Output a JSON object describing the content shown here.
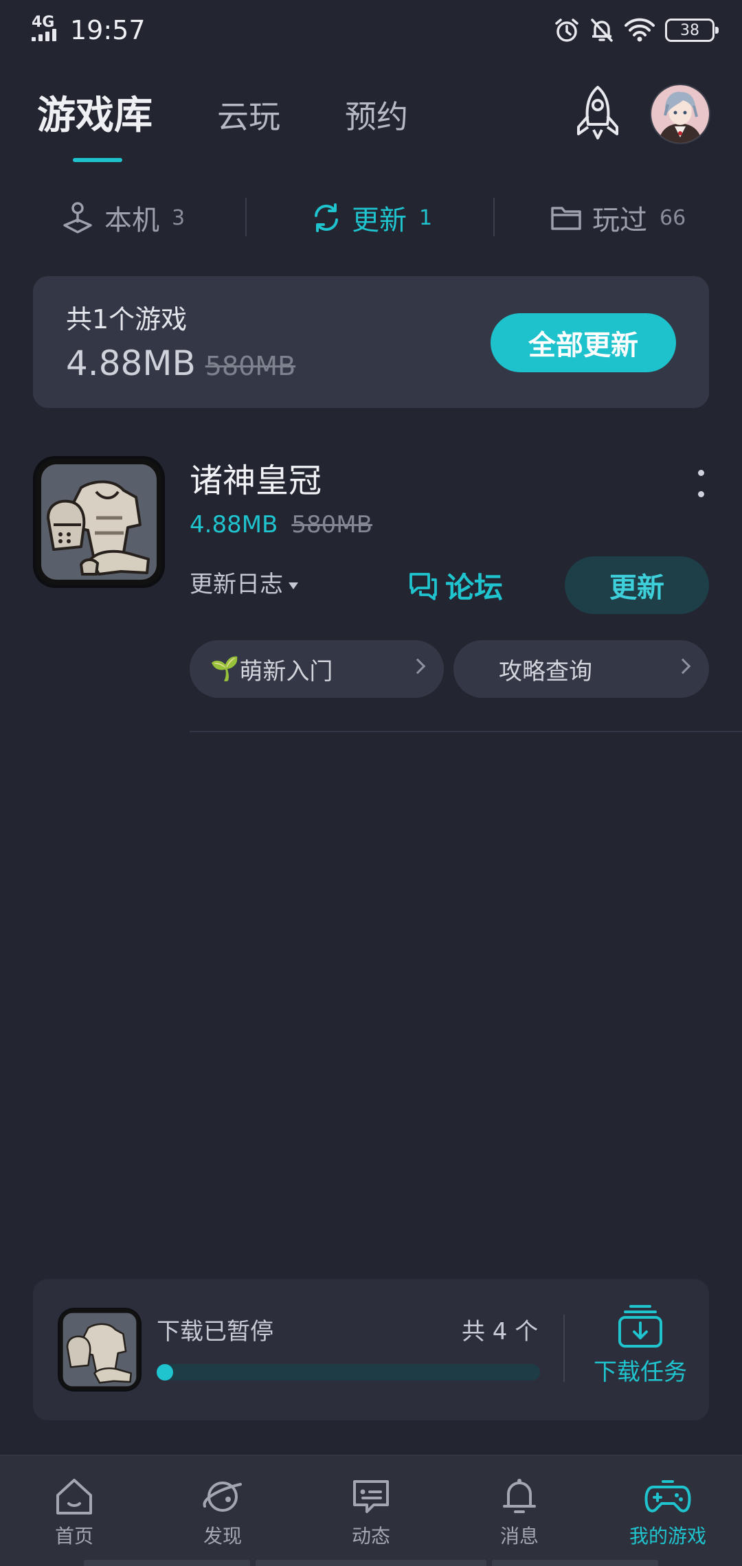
{
  "status_bar": {
    "network": "4G",
    "time": "19:57",
    "battery": "38",
    "icons": [
      "alarm-icon",
      "mute-bell-icon",
      "wifi-icon",
      "battery-icon"
    ]
  },
  "header": {
    "tabs": [
      {
        "label": "游戏库",
        "active": true
      },
      {
        "label": "云玩",
        "active": false
      },
      {
        "label": "预约",
        "active": false
      }
    ]
  },
  "subtabs": [
    {
      "label": "本机",
      "count": "3",
      "icon": "joystick-icon",
      "active": false
    },
    {
      "label": "更新",
      "count": "1",
      "icon": "refresh-icon",
      "active": true
    },
    {
      "label": "玩过",
      "count": "66",
      "icon": "folder-icon",
      "active": false
    }
  ],
  "summary": {
    "title": "共1个游戏",
    "size": "4.88MB",
    "original_size": "580MB",
    "update_all_label": "全部更新"
  },
  "game": {
    "name": "诸神皇冠",
    "size": "4.88MB",
    "original_size": "580MB",
    "changelog_label": "更新日志",
    "forum_label": "论坛",
    "update_label": "更新",
    "quick_links": [
      {
        "label": "萌新入门",
        "prefix": "🌱"
      },
      {
        "label": "攻略查询",
        "prefix": ""
      }
    ]
  },
  "download": {
    "status": "下载已暂停",
    "count": "共 4 个",
    "progress": 0.02,
    "tasks_label": "下载任务"
  },
  "bottom_nav": [
    {
      "label": "首页",
      "icon": "home-icon",
      "active": false
    },
    {
      "label": "发现",
      "icon": "planet-icon",
      "active": false
    },
    {
      "label": "动态",
      "icon": "chat-icon",
      "active": false
    },
    {
      "label": "消息",
      "icon": "bell-icon",
      "active": false
    },
    {
      "label": "我的游戏",
      "icon": "gamepad-icon",
      "active": true
    }
  ],
  "colors": {
    "background": "#232530",
    "accent": "#1ec2cc",
    "card": "#343846"
  }
}
